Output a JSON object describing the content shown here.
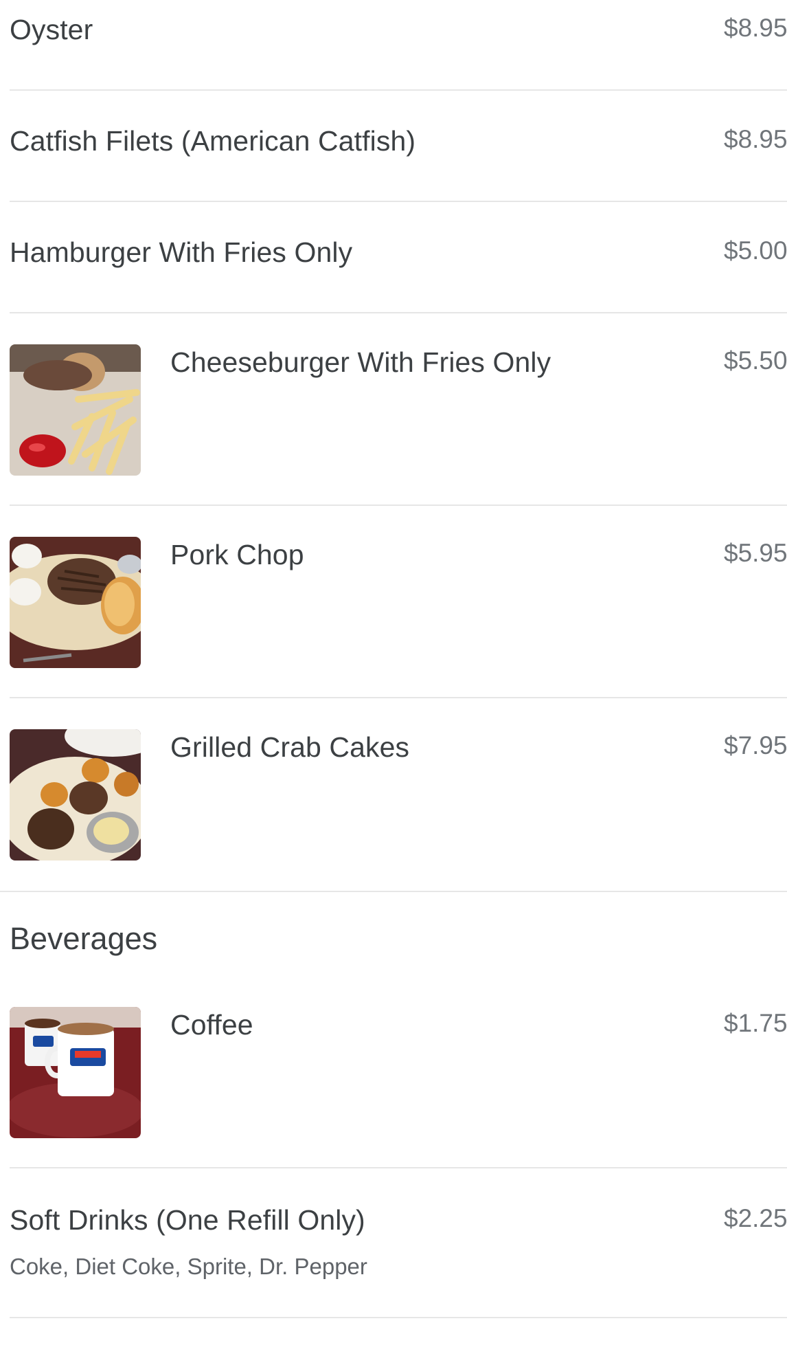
{
  "menu_items": [
    {
      "name": "Oyster",
      "price": "$8.95"
    },
    {
      "name": "Catfish Filets (American Catfish)",
      "price": "$8.95"
    },
    {
      "name": "Hamburger With Fries Only",
      "price": "$5.00"
    },
    {
      "name": "Cheeseburger With Fries Only",
      "price": "$5.50",
      "photo": "cheeseburger-photo"
    },
    {
      "name": "Pork Chop",
      "price": "$5.95",
      "photo": "pork-chop-photo"
    },
    {
      "name": "Grilled Crab Cakes",
      "price": "$7.95",
      "photo": "crab-cakes-photo"
    }
  ],
  "beverages": {
    "title": "Beverages",
    "items": [
      {
        "name": "Coffee",
        "price": "$1.75",
        "photo": "coffee-photo"
      },
      {
        "name": "Soft Drinks (One Refill Only)",
        "price": "$2.25",
        "description": "Coke, Diet Coke, Sprite, Dr. Pepper"
      }
    ]
  }
}
